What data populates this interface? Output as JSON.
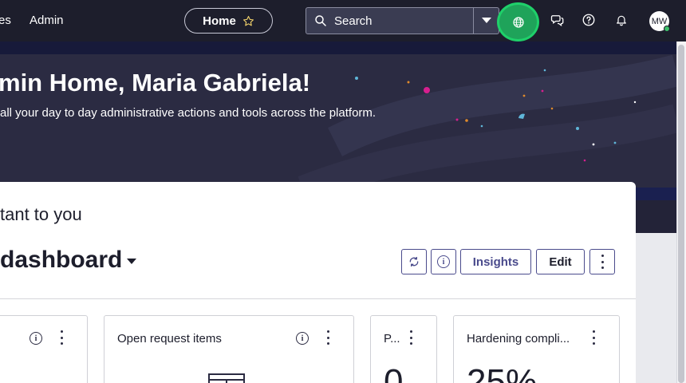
{
  "nav": {
    "item_partial": "es",
    "admin": "Admin",
    "home": "Home",
    "search_placeholder": "Search",
    "avatar_initials": "MW"
  },
  "icons": {
    "star": "star-icon",
    "search": "search-icon",
    "dropdown": "caret-down-icon",
    "globe": "globe-icon",
    "chat": "chat-icon",
    "help": "help-icon",
    "bell": "bell-icon",
    "refresh": "refresh-icon",
    "info": "info-icon",
    "more": "more-vertical-icon"
  },
  "colors": {
    "nav_bg": "#1d1e2c",
    "hero_bg": "#2b2b42",
    "globe_highlight": "#1fa35a",
    "accent_button_text": "#4a4b8c"
  },
  "hero": {
    "title": "min Home, Maria Gabriela!",
    "subtitle": "all your day to day administrative actions and tools across the platform."
  },
  "dashboard": {
    "section_title": "tant to you",
    "name": "dashboard",
    "buttons": {
      "insights": "Insights",
      "edit": "Edit"
    }
  },
  "widgets": [
    {
      "title": "",
      "value": ""
    },
    {
      "title": "Open request items",
      "value": ""
    },
    {
      "title": "P...",
      "value": "0"
    },
    {
      "title": "Hardening compli...",
      "value": "25%"
    }
  ],
  "info_glyph": "i"
}
